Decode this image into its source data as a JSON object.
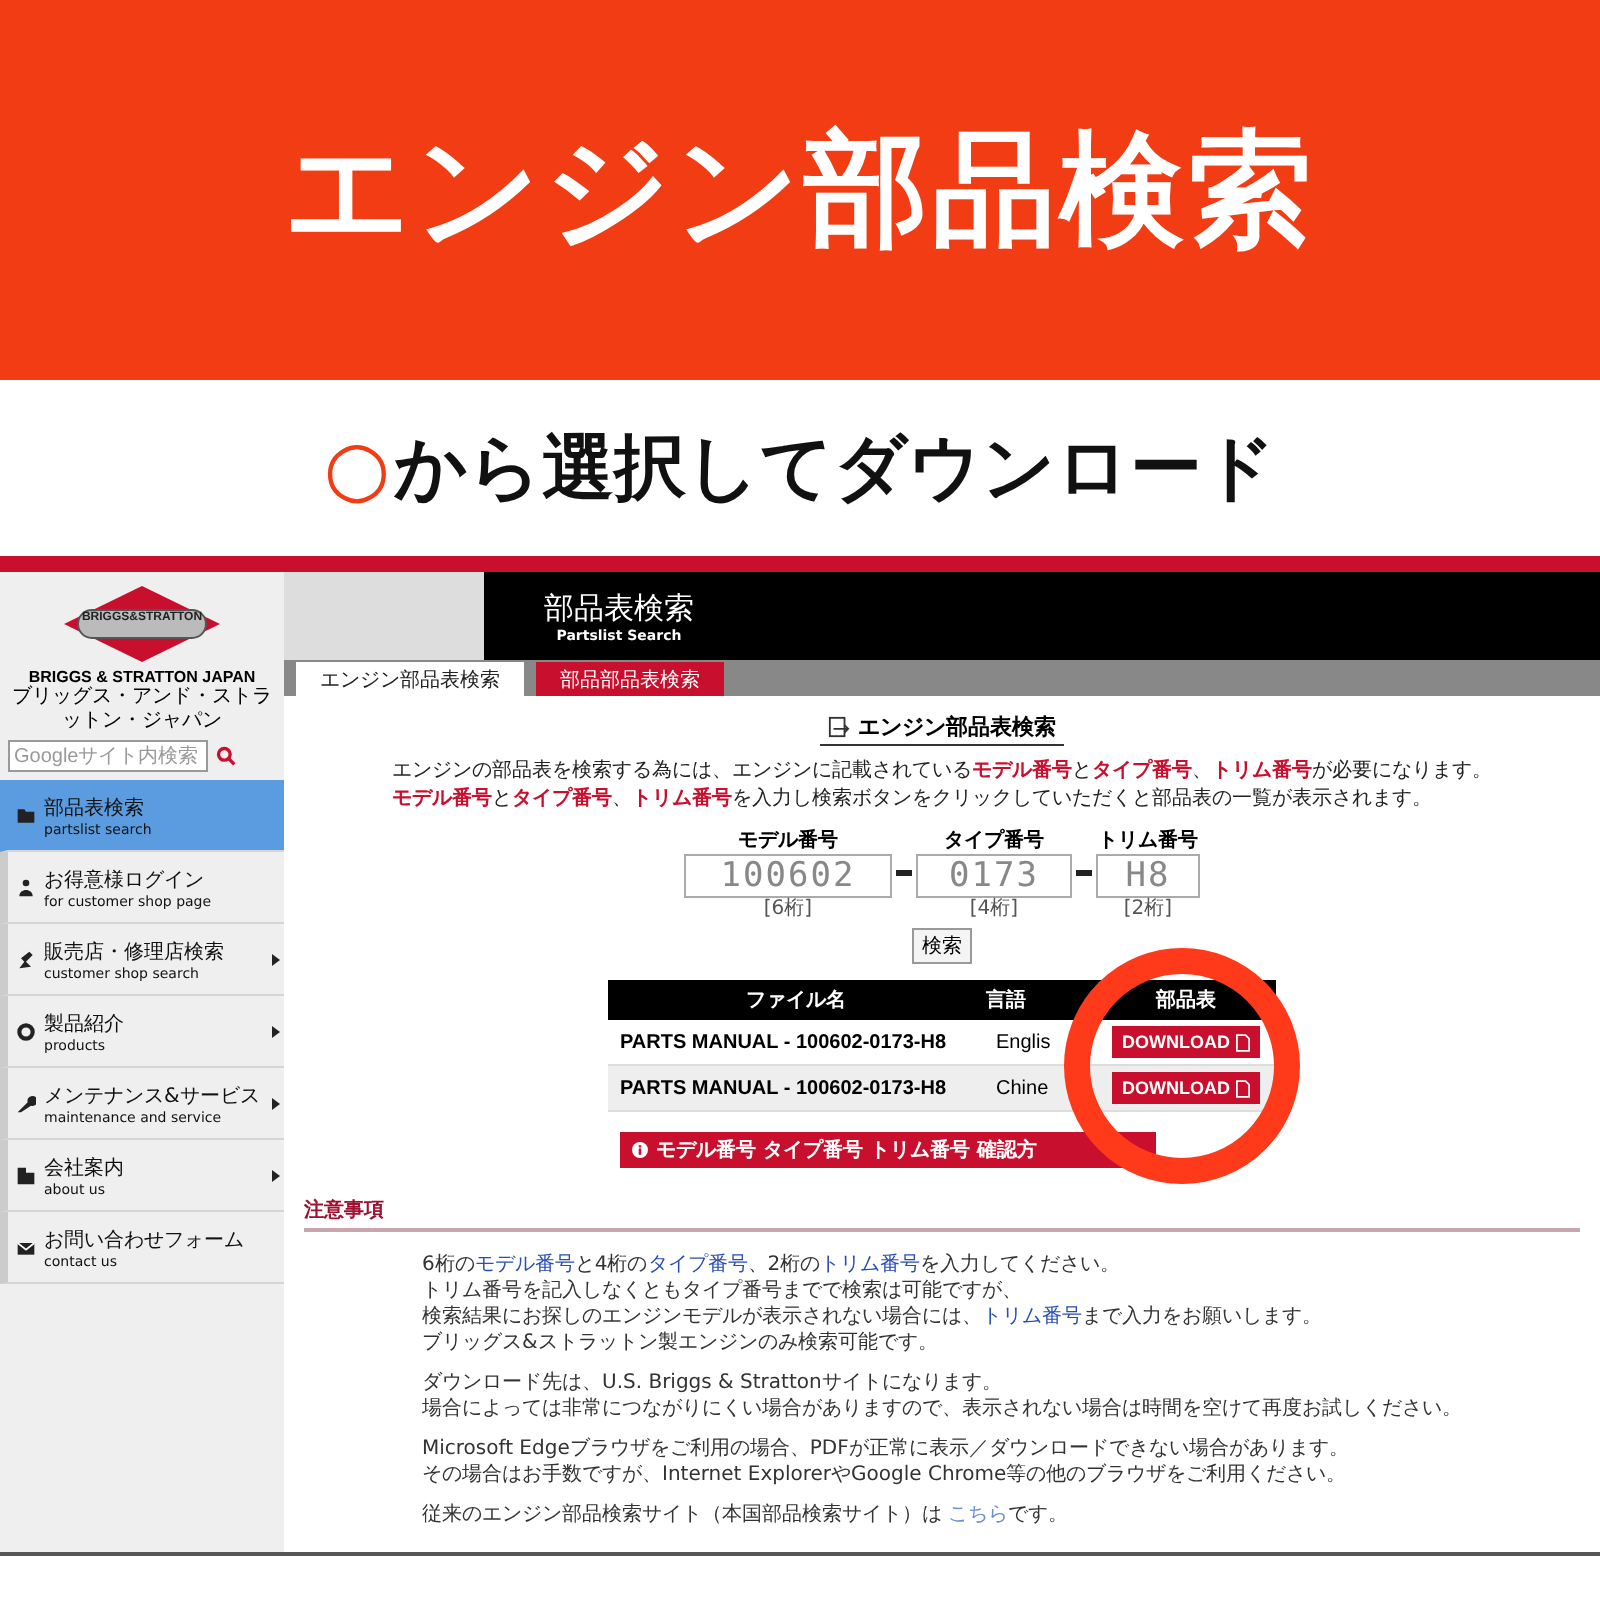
{
  "banner": {
    "title": "エンジン部品検索",
    "marker": "○",
    "subtitle": "から選択してダウンロード"
  },
  "sidebar": {
    "logo_text": "BRIGGS&STRATTON",
    "company": "BRIGGS & STRATTON JAPAN",
    "company_kana": "ブリッグス・アンド・ストラットン・ジャパン",
    "search": {
      "placeholder": "Googleサイト内検索"
    },
    "items": [
      {
        "label": "部品表検索",
        "sub": "partslist search",
        "selected": true,
        "submenu": false
      },
      {
        "label": "お得意様ログイン",
        "sub": "for customer shop page",
        "selected": false,
        "submenu": false
      },
      {
        "label": "販売店・修理店検索",
        "sub": "customer shop search",
        "selected": false,
        "submenu": true
      },
      {
        "label": "製品紹介",
        "sub": "products",
        "selected": false,
        "submenu": true
      },
      {
        "label": "メンテナンス&サービス",
        "sub": "maintenance and service",
        "selected": false,
        "submenu": true
      },
      {
        "label": "会社案内",
        "sub": "about us",
        "selected": false,
        "submenu": true
      },
      {
        "label": "お問い合わせフォーム",
        "sub": "contact us",
        "selected": false,
        "submenu": false
      }
    ]
  },
  "header": {
    "title": "部品表検索",
    "subtitle": "Partslist Search"
  },
  "tabs": [
    {
      "label": "エンジン部品表検索",
      "selected": true
    },
    {
      "label": "部品部品表検索",
      "selected": false
    }
  ],
  "content": {
    "title": "エンジン部品表検索",
    "intro": [
      [
        {
          "text": "エンジンの部品表を検索する為には、エンジンに記載されている",
          "kind": "plain"
        },
        {
          "text": "モデル番号",
          "kind": "highlight"
        },
        {
          "text": "と",
          "kind": "plain"
        },
        {
          "text": "タイプ番号",
          "kind": "highlight"
        },
        {
          "text": "、",
          "kind": "plain"
        },
        {
          "text": "トリム番号",
          "kind": "highlight"
        },
        {
          "text": "が必要になります。",
          "kind": "plain"
        }
      ],
      [
        {
          "text": "モデル番号",
          "kind": "highlight"
        },
        {
          "text": "と",
          "kind": "plain"
        },
        {
          "text": "タイプ番号",
          "kind": "highlight"
        },
        {
          "text": "、",
          "kind": "plain"
        },
        {
          "text": "トリム番号",
          "kind": "highlight"
        },
        {
          "text": "を入力し検索ボタンをクリックしていただくと部品表の一覧が表示されます。",
          "kind": "plain"
        }
      ]
    ],
    "fields": [
      {
        "label": "モデル番号",
        "value": "100602",
        "hint": "[6桁]"
      },
      {
        "label": "タイプ番号",
        "value": "0173",
        "hint": "[4桁]"
      },
      {
        "label": "トリム番号",
        "value": "H8",
        "hint": "[2桁]"
      }
    ],
    "search_button": "検索",
    "table": {
      "columns": [
        "ファイル名",
        "言語",
        "部品表"
      ],
      "rows": [
        {
          "file": "PARTS MANUAL - 100602-0173-H8",
          "language": "Englis",
          "action": "DOWNLOAD"
        },
        {
          "file": "PARTS MANUAL - 100602-0173-H8",
          "language": "Chine",
          "action": "DOWNLOAD"
        }
      ]
    },
    "help_button": "モデル番号 タイプ番号 トリム番号 確認方",
    "notes_title": "注意事項",
    "notes": [
      [
        [
          {
            "text": "6桁の",
            "kind": "plain"
          },
          {
            "text": "モデル番号",
            "kind": "highlight"
          },
          {
            "text": "と4桁の",
            "kind": "plain"
          },
          {
            "text": "タイプ番号",
            "kind": "highlight"
          },
          {
            "text": "、2桁の",
            "kind": "plain"
          },
          {
            "text": "トリム番号",
            "kind": "highlight"
          },
          {
            "text": "を入力してください。",
            "kind": "plain"
          }
        ],
        [
          {
            "text": "トリム番号を記入しなくともタイプ番号までで検索は可能ですが、",
            "kind": "plain"
          }
        ],
        [
          {
            "text": "検索結果にお探しのエンジンモデルが表示されない場合には、",
            "kind": "plain"
          },
          {
            "text": "トリム番号",
            "kind": "highlight"
          },
          {
            "text": "まで入力をお願いします。",
            "kind": "plain"
          }
        ],
        [
          {
            "text": "ブリッグス&ストラットン製エンジンのみ検索可能です。",
            "kind": "plain"
          }
        ]
      ],
      [
        [
          {
            "text": "ダウンロード先は、U.S. Briggs & Strattonサイトになります。",
            "kind": "plain"
          }
        ],
        [
          {
            "text": "場合によっては非常につながりにくい場合がありますので、表示されない場合は時間を空けて再度お試しください。",
            "kind": "plain"
          }
        ]
      ],
      [
        [
          {
            "text": "Microsoft Edgeブラウザをご利用の場合、PDFが正常に表示／ダウンロードできない場合があります。",
            "kind": "plain"
          }
        ],
        [
          {
            "text": "その場合はお手数ですが、Internet ExplorerやGoogle Chrome等の他のブラウザをご利用ください。",
            "kind": "plain"
          }
        ]
      ],
      [
        [
          {
            "text": "従来のエンジン部品検索サイト（本国部品検索サイト）は ",
            "kind": "plain"
          },
          {
            "text": "こちら",
            "kind": "link"
          },
          {
            "text": "です。",
            "kind": "plain"
          }
        ]
      ]
    ]
  }
}
